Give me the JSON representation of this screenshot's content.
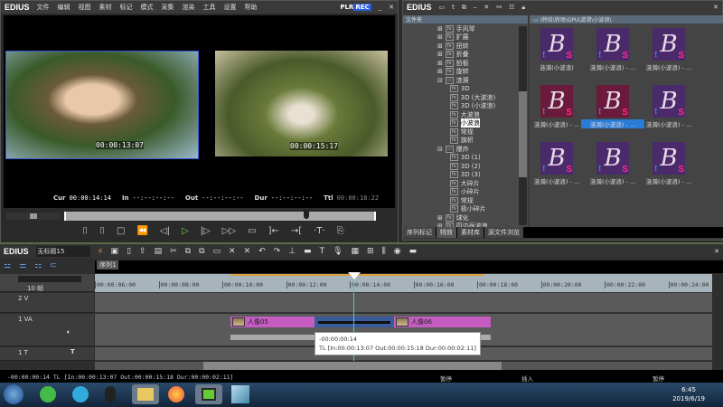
{
  "player": {
    "logo": "EDIUS",
    "menu": [
      "文件",
      "编辑",
      "视图",
      "素材",
      "标记",
      "模式",
      "采集",
      "渲染",
      "工具",
      "设置",
      "帮助"
    ],
    "plr": "PLR",
    "rec": "REC",
    "left_tc": "00:00:13:07",
    "right_tc": "00:00:15:17",
    "cur_label": "Cur",
    "cur": "00:00:14:14",
    "in_label": "In",
    "in": "--:--:--:--",
    "out_label": "Out",
    "out": "--:--:--:--",
    "dur_label": "Dur",
    "dur": "--:--:--:--",
    "ttl_label": "Ttl",
    "ttl": "00:00:18:22",
    "scrub_position_pct": 77
  },
  "bin": {
    "logo": "EDIUS",
    "folder_header": "文件夹",
    "path": "\\特效\\转场\\GPU\\滤滑\\小波浪\\",
    "tree": [
      {
        "label": "手风琴",
        "level": 1,
        "exp": "+"
      },
      {
        "label": "扩展",
        "level": 1,
        "exp": "+"
      },
      {
        "label": "扭转",
        "level": 1,
        "exp": "+"
      },
      {
        "label": "折叠",
        "level": 1,
        "exp": "+"
      },
      {
        "label": "拍板",
        "level": 1,
        "exp": "+"
      },
      {
        "label": "旋转",
        "level": 1,
        "exp": "+"
      },
      {
        "label": "涟漪",
        "level": 1,
        "exp": "-",
        "folder": true
      },
      {
        "label": "3D",
        "level": 2
      },
      {
        "label": "3D (大波浪)",
        "level": 2
      },
      {
        "label": "3D (小波浪)",
        "level": 2
      },
      {
        "label": "大波浪",
        "level": 2
      },
      {
        "label": "小波浪",
        "level": 2,
        "selected": true
      },
      {
        "label": "常规",
        "level": 2
      },
      {
        "label": "旗帜",
        "level": 2
      },
      {
        "label": "爆炸",
        "level": 1,
        "exp": "-",
        "folder": true
      },
      {
        "label": "3D (1)",
        "level": 2
      },
      {
        "label": "3D (2)",
        "level": 2
      },
      {
        "label": "3D (3)",
        "level": 2
      },
      {
        "label": "大碎片",
        "level": 2
      },
      {
        "label": "小碎片",
        "level": 2
      },
      {
        "label": "常规",
        "level": 2
      },
      {
        "label": "极小碎片",
        "level": 2
      },
      {
        "label": "球化",
        "level": 1,
        "exp": "+"
      },
      {
        "label": "四边画波浪",
        "level": 1,
        "exp": "+"
      }
    ],
    "thumbs": [
      {
        "label": "涟漪(小波浪)",
        "color": "#4a2a6a"
      },
      {
        "label": "涟漪(小波浪) - ...",
        "color": "#4a2a6a"
      },
      {
        "label": "涟漪(小波浪) - ...",
        "color": "#4a2a6a"
      },
      {
        "label": "涟漪(小波浪) - ...",
        "color": "#6a1a3a"
      },
      {
        "label": "涟漪(小波浪) - ...",
        "color": "#6a1a3a",
        "selected": true
      },
      {
        "label": "涟漪(小波浪) - ...",
        "color": "#4a2a6a"
      },
      {
        "label": "涟漪(小波浪) - ...",
        "color": "#4a2a6a"
      },
      {
        "label": "涟漪(小波浪) - ...",
        "color": "#4a2a6a"
      },
      {
        "label": "涟漪(小波浪) - ...",
        "color": "#4a2a6a"
      }
    ],
    "thumb_glyph": "B",
    "thumb_badge": "S",
    "tabs": [
      "序列标记",
      "特效",
      "素材库",
      "源文件浏览"
    ]
  },
  "timeline": {
    "logo": "EDIUS",
    "project": "无标题15",
    "sequence_tab": "序列1",
    "zoom": "10 帧",
    "ruler": [
      "00:00:06:00",
      "00:00:08:00",
      "00:00:10:00",
      "00:00:12:00",
      "00:00:14:00",
      "00:00:16:00",
      "00:00:18:00",
      "00:00:20:00",
      "00:00:22:00",
      "00:00:24:00"
    ],
    "tracks": [
      {
        "name": "2 V"
      },
      {
        "name": "1 VA"
      },
      {
        "name": "1 T"
      }
    ],
    "clips": [
      {
        "label": "人像05"
      },
      {
        "label": "人像06"
      }
    ],
    "tooltip": {
      "line1": "-00:00:00:14",
      "line2": "TL [In:00:00:13:07 Out:00:00:15:18 Dur:00:00:02:11]"
    },
    "status": "-00:00:00:14 TL [In:00:00:13:07 Out:00:00:15:18 Dur:00:00:02:11]",
    "status_pause": "暂停",
    "status_insert": "插入",
    "status_pause2": "暂停"
  },
  "taskbar": {
    "time": "6:45",
    "date": "2019/6/19"
  }
}
